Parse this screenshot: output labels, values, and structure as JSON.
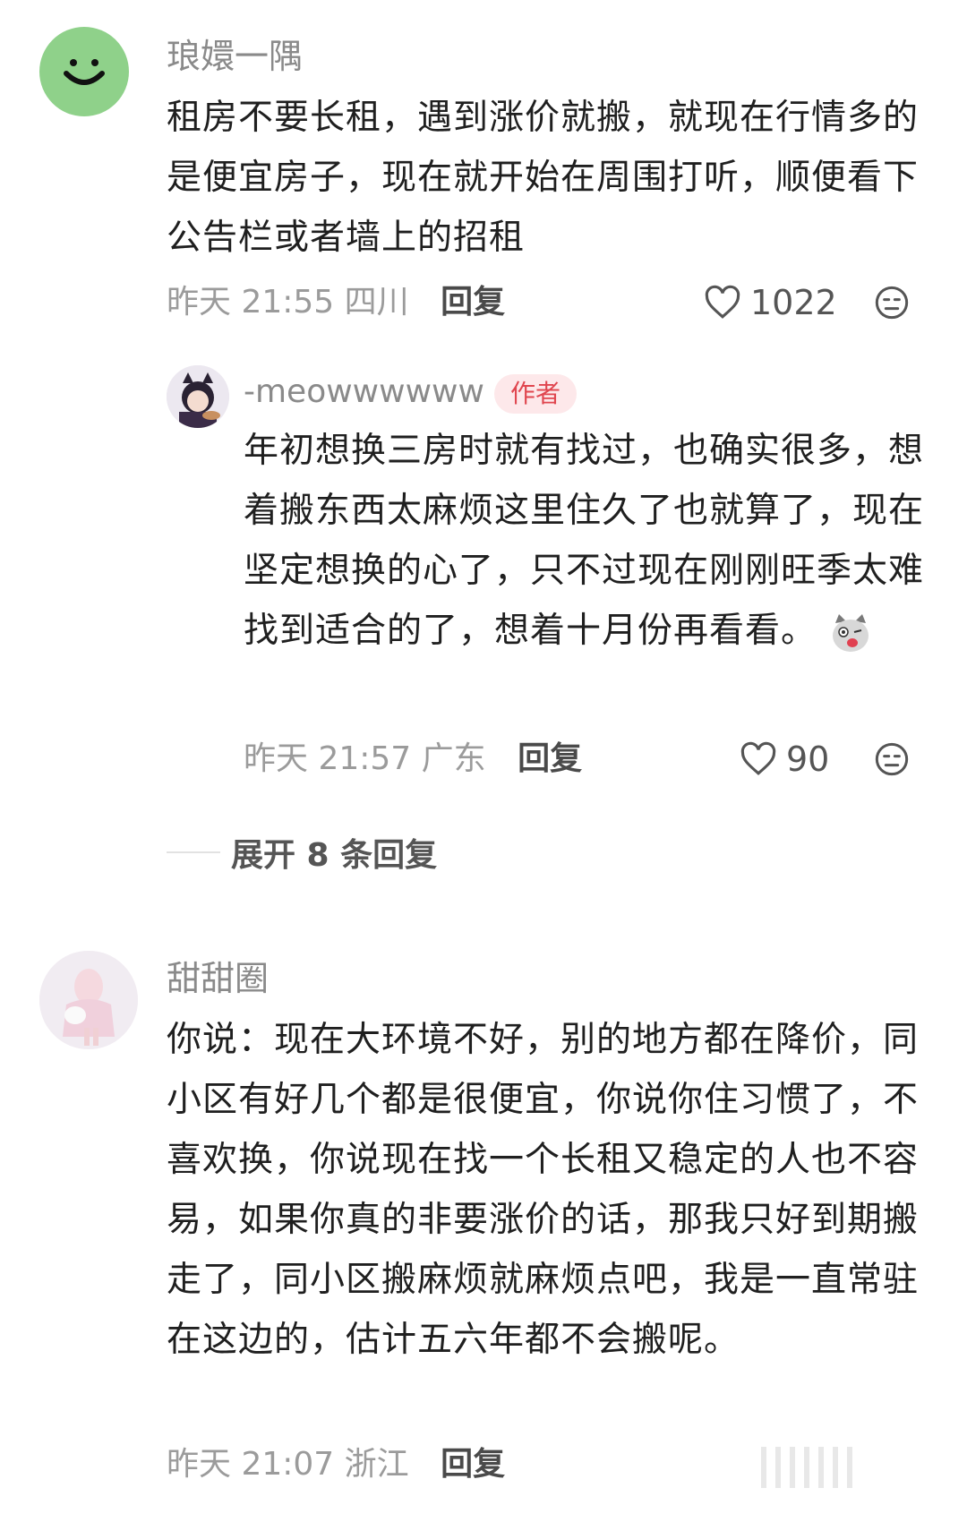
{
  "comments": [
    {
      "username": "琅嬛一隅",
      "text": "租房不要长租，遇到涨价就搬，就现在行情多的是便宜房子，现在就开始在周围打听，顺便看下公告栏或者墙上的招租",
      "time": "昨天 21:55",
      "location": "四川",
      "reply_label": "回复",
      "likes": "1022",
      "avatar_icon": "smiley-face-icon",
      "avatar_color": "#8fd18a"
    },
    {
      "username": "-meowwwwww",
      "badge": "作者",
      "text": "年初想换三房时就有找过，也确实很多，想着搬东西太麻烦这里住久了也就算了，现在坚定想换的心了，只不过现在刚刚旺季太难找到适合的了，想着十月份再看看。",
      "time": "昨天 21:57",
      "location": "广东",
      "reply_label": "回复",
      "likes": "90",
      "emoji_icon": "cat-face-sticker-icon"
    },
    {
      "expand_label": "展开 8 条回复"
    },
    {
      "username": "甜甜圈",
      "text": "你说：现在大环境不好，别的地方都在降价，同小区有好几个都是很便宜，你说你住习惯了，不喜欢换，你说现在找一个长租又稳定的人也不容易，如果你真的非要涨价的话，那我只好到期搬走了，同小区搬麻烦就麻烦点吧，我是一直常驻在这边的，估计五六年都不会搬呢。",
      "time": "昨天 21:07",
      "location": "浙江",
      "reply_label": "回复"
    }
  ],
  "colors": {
    "accent_badge": "#e0464f",
    "meta_gray": "#9b9b9b"
  }
}
